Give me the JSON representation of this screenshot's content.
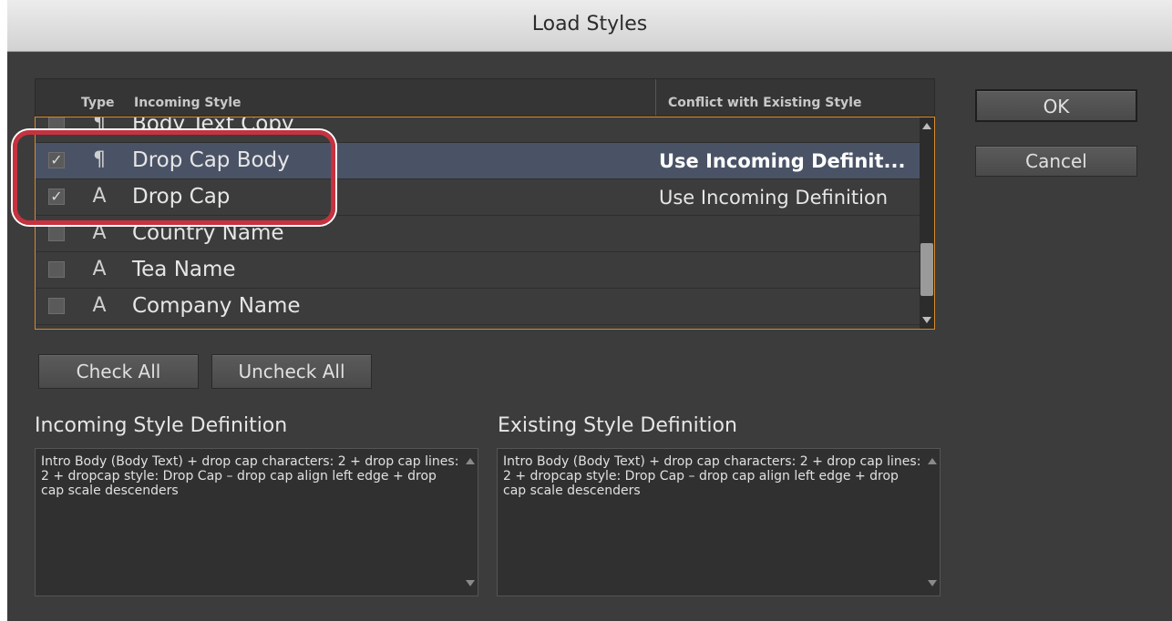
{
  "window": {
    "title": "Load Styles"
  },
  "table": {
    "headers": {
      "type": "Type",
      "incoming": "Incoming Style",
      "conflict": "Conflict with Existing Style"
    },
    "rows": [
      {
        "checked": false,
        "type_icon": "¶",
        "name": "Body Text Copy",
        "conflict": "",
        "selected": false
      },
      {
        "checked": true,
        "type_icon": "¶",
        "name": "Drop Cap Body",
        "conflict": "Use Incoming Definit...",
        "selected": true
      },
      {
        "checked": true,
        "type_icon": "A",
        "name": "Drop Cap",
        "conflict": "Use Incoming Definition",
        "selected": false
      },
      {
        "checked": false,
        "type_icon": "A",
        "name": "Country Name",
        "conflict": "",
        "selected": false
      },
      {
        "checked": false,
        "type_icon": "A",
        "name": "Tea Name",
        "conflict": "",
        "selected": false
      },
      {
        "checked": false,
        "type_icon": "A",
        "name": "Company Name",
        "conflict": "",
        "selected": false
      }
    ],
    "check_mark": "✓"
  },
  "buttons": {
    "ok": "OK",
    "cancel": "Cancel",
    "check_all": "Check All",
    "uncheck_all": "Uncheck All"
  },
  "incoming_def": {
    "title": "Incoming Style Definition",
    "text": "Intro Body (Body Text) + drop cap characters: 2 + drop cap lines: 2 + dropcap style: Drop Cap – drop cap align left edge + drop cap scale descenders"
  },
  "existing_def": {
    "title": "Existing Style Definition",
    "text": "Intro Body (Body Text) + drop cap characters: 2 + drop cap lines: 2 + dropcap style: Drop Cap – drop cap align left edge + drop cap scale descenders"
  },
  "colors": {
    "dialog_bg": "#3c3c3c",
    "selection": "#4a5366",
    "focus_border": "#d98a2b",
    "callout": "#c6323f"
  }
}
